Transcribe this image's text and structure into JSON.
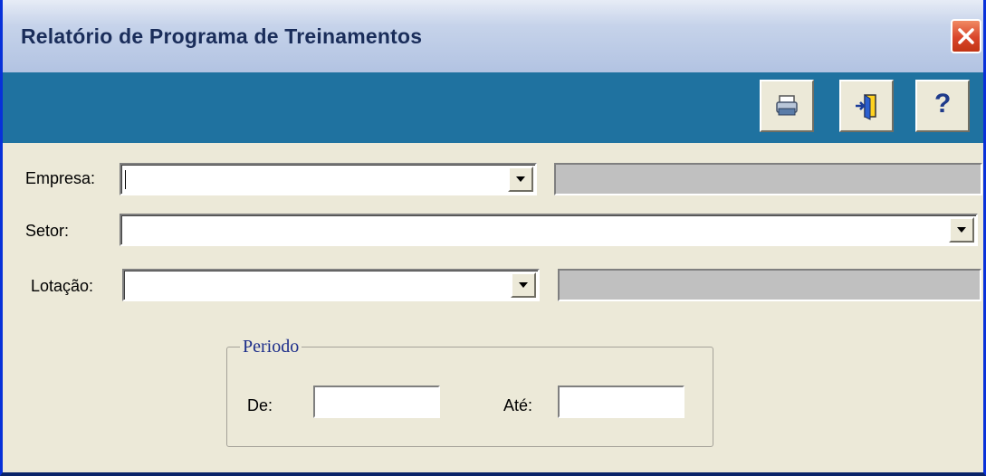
{
  "window": {
    "title": "Relatório de Programa de Treinamentos"
  },
  "toolbar": {
    "buttons": [
      {
        "icon": "printer-icon"
      },
      {
        "icon": "exit-door-icon"
      },
      {
        "icon": "help-icon",
        "label": "?"
      }
    ]
  },
  "form": {
    "empresa": {
      "label": "Empresa:",
      "value": "",
      "description": ""
    },
    "setor": {
      "label": "Setor:",
      "value": ""
    },
    "lotacao": {
      "label": "Lotação:",
      "value": "",
      "description": ""
    },
    "periodo": {
      "legend": "Periodo",
      "de_label": "De:",
      "de_value": "",
      "ate_label": "Até:",
      "ate_value": ""
    }
  },
  "colors": {
    "toolbar_bg": "#1f72a0",
    "form_bg": "#ece9d8",
    "legend_text": "#1c2d8a",
    "close_button": "#d9452a"
  }
}
